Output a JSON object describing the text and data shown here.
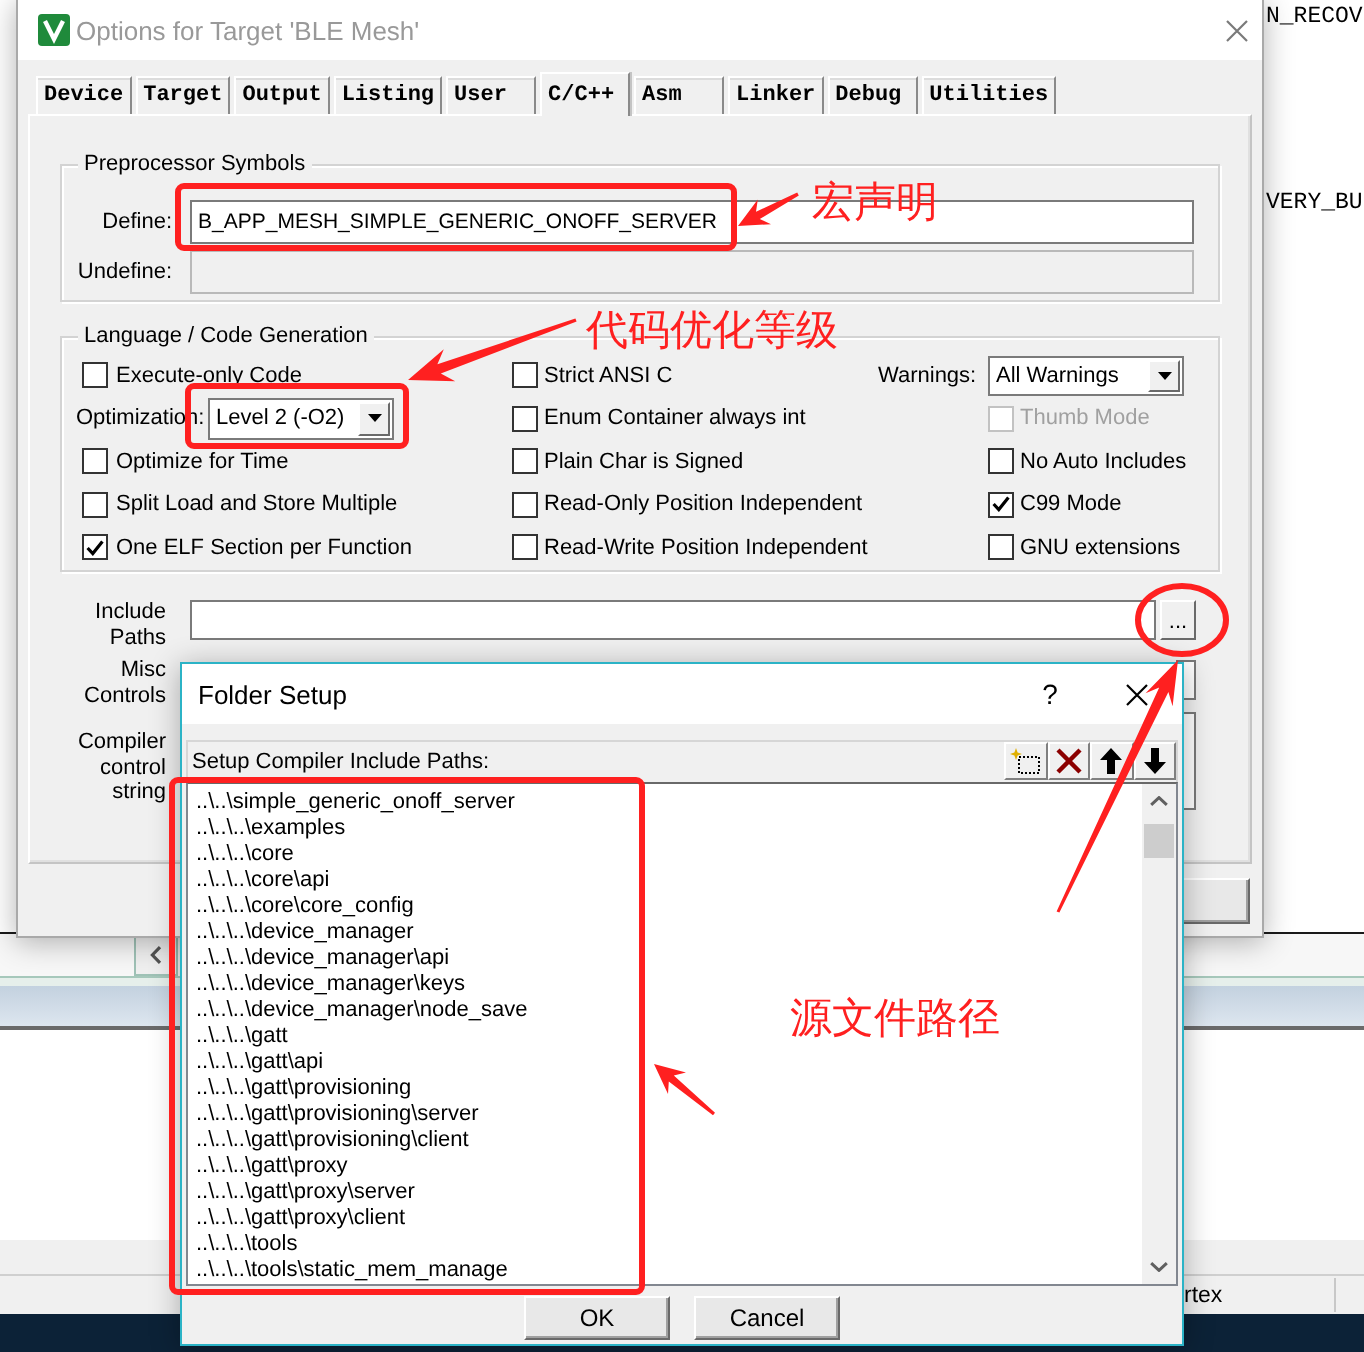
{
  "editor": {
    "code_lines": [
      "N_RECOV",
      "VERY_BU"
    ]
  },
  "status_bar": {
    "text": "rtex"
  },
  "options_dialog": {
    "title": "Options for Target 'BLE Mesh'",
    "tabs": [
      {
        "label": "Device",
        "selected": false
      },
      {
        "label": "Target",
        "selected": false
      },
      {
        "label": "Output",
        "selected": false
      },
      {
        "label": "Listing",
        "selected": false
      },
      {
        "label": "User",
        "selected": false
      },
      {
        "label": "C/C++",
        "selected": true
      },
      {
        "label": "Asm",
        "selected": false
      },
      {
        "label": "Linker",
        "selected": false
      },
      {
        "label": "Debug",
        "selected": false
      },
      {
        "label": "Utilities",
        "selected": false
      }
    ],
    "preprocessor": {
      "title": "Preprocessor Symbols",
      "define": {
        "label": "Define:",
        "value": "B_APP_MESH_SIMPLE_GENERIC_ONOFF_SERVER",
        "disabled": false
      },
      "undefine": {
        "label": "Undefine:",
        "disabled": true
      }
    },
    "language": {
      "title": "Language / Code Generation",
      "columns": [
        [
          {
            "kind": "checkbox",
            "label": "Execute-only Code",
            "checked": false,
            "disabled": false
          },
          {
            "kind": "dropdown",
            "label": "Optimization:",
            "value": "Level 2 (-O2)",
            "disabled": false
          },
          {
            "kind": "checkbox",
            "label": "Optimize for Time",
            "checked": false,
            "disabled": false
          },
          {
            "kind": "checkbox",
            "label": "Split Load and Store Multiple",
            "checked": false,
            "disabled": false
          },
          {
            "kind": "checkbox",
            "label": "One ELF Section per Function",
            "checked": true,
            "disabled": false
          }
        ],
        [
          {
            "kind": "checkbox",
            "label": "Strict ANSI C",
            "checked": false,
            "disabled": false
          },
          {
            "kind": "checkbox",
            "label": "Enum Container always int",
            "checked": false,
            "disabled": false
          },
          {
            "kind": "checkbox",
            "label": "Plain Char is Signed",
            "checked": false,
            "disabled": false
          },
          {
            "kind": "checkbox",
            "label": "Read-Only Position Independent",
            "checked": false,
            "disabled": false
          },
          {
            "kind": "checkbox",
            "label": "Read-Write Position Independent",
            "checked": false,
            "disabled": false
          }
        ],
        [
          {
            "kind": "dropdown",
            "label": "Warnings:",
            "value": "All Warnings",
            "disabled": false
          },
          {
            "kind": "checkbox",
            "label": "Thumb Mode",
            "checked": false,
            "disabled": true
          },
          {
            "kind": "checkbox",
            "label": "No Auto Includes",
            "checked": false,
            "disabled": false
          },
          {
            "kind": "checkbox",
            "label": "C99 Mode",
            "checked": true,
            "disabled": false
          },
          {
            "kind": "checkbox",
            "label": "GNU extensions",
            "checked": false,
            "disabled": false
          }
        ]
      ]
    },
    "include_paths": {
      "label": "Include Paths",
      "button": "..."
    },
    "misc_controls": {
      "label": "Misc Controls"
    },
    "compiler_string": {
      "label": "Compiler control string"
    }
  },
  "folder_dialog": {
    "title": "Folder Setup",
    "help": "?",
    "list_title": "Setup Compiler Include Paths:",
    "paths": [
      {
        "path": "..\\..\\simple_generic_onoff_server",
        "selected": false
      },
      {
        "path": "..\\..\\..\\examples",
        "selected": false
      },
      {
        "path": "..\\..\\..\\core",
        "selected": false
      },
      {
        "path": "..\\..\\..\\core\\api",
        "selected": false
      },
      {
        "path": "..\\..\\..\\core\\core_config",
        "selected": false
      },
      {
        "path": "..\\..\\..\\device_manager",
        "selected": false
      },
      {
        "path": "..\\..\\..\\device_manager\\api",
        "selected": false
      },
      {
        "path": "..\\..\\..\\device_manager\\keys",
        "selected": false
      },
      {
        "path": "..\\..\\..\\device_manager\\node_save",
        "selected": false
      },
      {
        "path": "..\\..\\..\\gatt",
        "selected": false
      },
      {
        "path": "..\\..\\..\\gatt\\api",
        "selected": false
      },
      {
        "path": "..\\..\\..\\gatt\\provisioning",
        "selected": false
      },
      {
        "path": "..\\..\\..\\gatt\\provisioning\\server",
        "selected": false
      },
      {
        "path": "..\\..\\..\\gatt\\provisioning\\client",
        "selected": false
      },
      {
        "path": "..\\..\\..\\gatt\\proxy",
        "selected": false
      },
      {
        "path": "..\\..\\..\\gatt\\proxy\\server",
        "selected": false
      },
      {
        "path": "..\\..\\..\\gatt\\proxy\\client",
        "selected": false
      },
      {
        "path": "..\\..\\..\\tools",
        "selected": false
      },
      {
        "path": "..\\..\\..\\tools\\static_mem_manage",
        "selected": false
      }
    ],
    "buttons": [
      "OK",
      "Cancel"
    ]
  },
  "annotations": {
    "define_note": "宏声明",
    "optimization_note": "代码优化等级",
    "paths_note": "源文件路径"
  }
}
